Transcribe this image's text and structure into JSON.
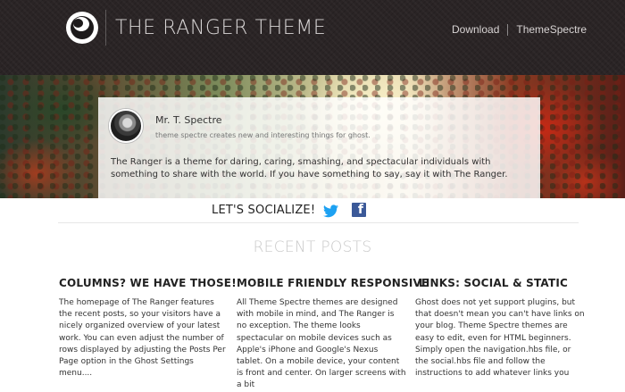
{
  "header": {
    "site_title": "THE RANGER THEME",
    "nav": [
      {
        "label": "Download"
      },
      {
        "label": "ThemeSpectre"
      }
    ]
  },
  "hero": {
    "author_name": "Mr. T. Spectre",
    "author_bio": "theme spectre creates new and interesting things for ghost.",
    "description": "The Ranger is a theme for daring, caring, smashing, and spectacular individuals with something to share with the world. If you have something to say, say it with The Ranger."
  },
  "social": {
    "label": "LET'S SOCIALIZE!",
    "icons": [
      "twitter-icon",
      "facebook-icon"
    ],
    "twitter_color": "#1da1f2",
    "facebook_color": "#3b5998"
  },
  "recent": {
    "title": "RECENT POSTS",
    "posts": [
      {
        "title": "COLUMNS? WE HAVE THOSE!",
        "excerpt": "The homepage of The Ranger features the recent posts, so your visitors have a nicely organized overview of your latest work. You can even adjust the number of rows displayed by adjusting the Posts Per Page option in the Ghost Settings menu...."
      },
      {
        "title": "MOBILE FRIENDLY RESPONSIVE",
        "excerpt": "All Theme Spectre themes are designed with mobile in mind, and The Ranger is no exception. The theme looks spectacular on mobile devices such as Apple's iPhone and Google's Nexus tablet. On a mobile device, your content is front and center. On larger screens with a bit"
      },
      {
        "title": "LINKS: SOCIAL & STATIC",
        "excerpt": "Ghost does not yet support plugins, but that doesn't mean you can't have links on your blog. Theme Spectre themes are easy to edit, even for HTML beginners. Simply open the navigation.hbs file, or the social.hbs file and follow the instructions to add whatever links you"
      }
    ]
  }
}
